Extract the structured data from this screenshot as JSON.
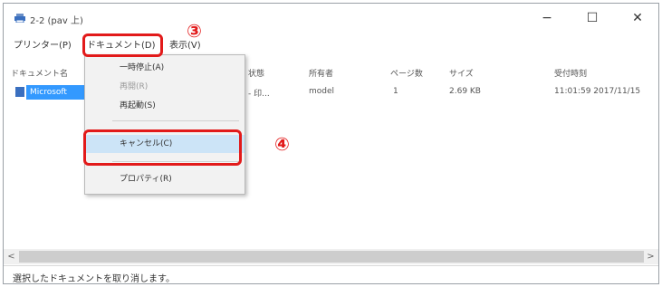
{
  "window": {
    "title": "2-2 (pav 上)",
    "minimize": "−",
    "maximize": "☐",
    "close": "✕"
  },
  "menubar": {
    "items": [
      "プリンター(P)",
      "ドキュメント(D)",
      "表示(V)"
    ]
  },
  "annotations": {
    "step3": "③",
    "step4": "④",
    "highlight_color": "#e21a1a"
  },
  "table": {
    "columns": [
      "ドキュメント名",
      "状態",
      "所有者",
      "ページ数",
      "サイズ",
      "受付時刻"
    ],
    "rows": [
      {
        "name": "Microsoft",
        "status": "- 印...",
        "owner": "model",
        "pages": "1",
        "size": "2.69 KB",
        "submitted": "11:01:59 2017/11/15"
      }
    ]
  },
  "dropdown": {
    "items": [
      {
        "label": "一時停止(A)",
        "disabled": false
      },
      {
        "label": "再開(R)",
        "disabled": true
      },
      {
        "label": "再起動(S)",
        "disabled": false
      },
      {
        "label": "キャンセル(C)",
        "disabled": false,
        "highlighted": true
      },
      {
        "label": "プロパティ(R)",
        "disabled": false
      }
    ]
  },
  "scrollbar": {
    "left_arrow": "<",
    "right_arrow": ">"
  },
  "status": {
    "text": "選択したドキュメントを取り消します。"
  },
  "colors": {
    "selection": "#3399ff",
    "menu_highlight": "#cce4f7"
  }
}
